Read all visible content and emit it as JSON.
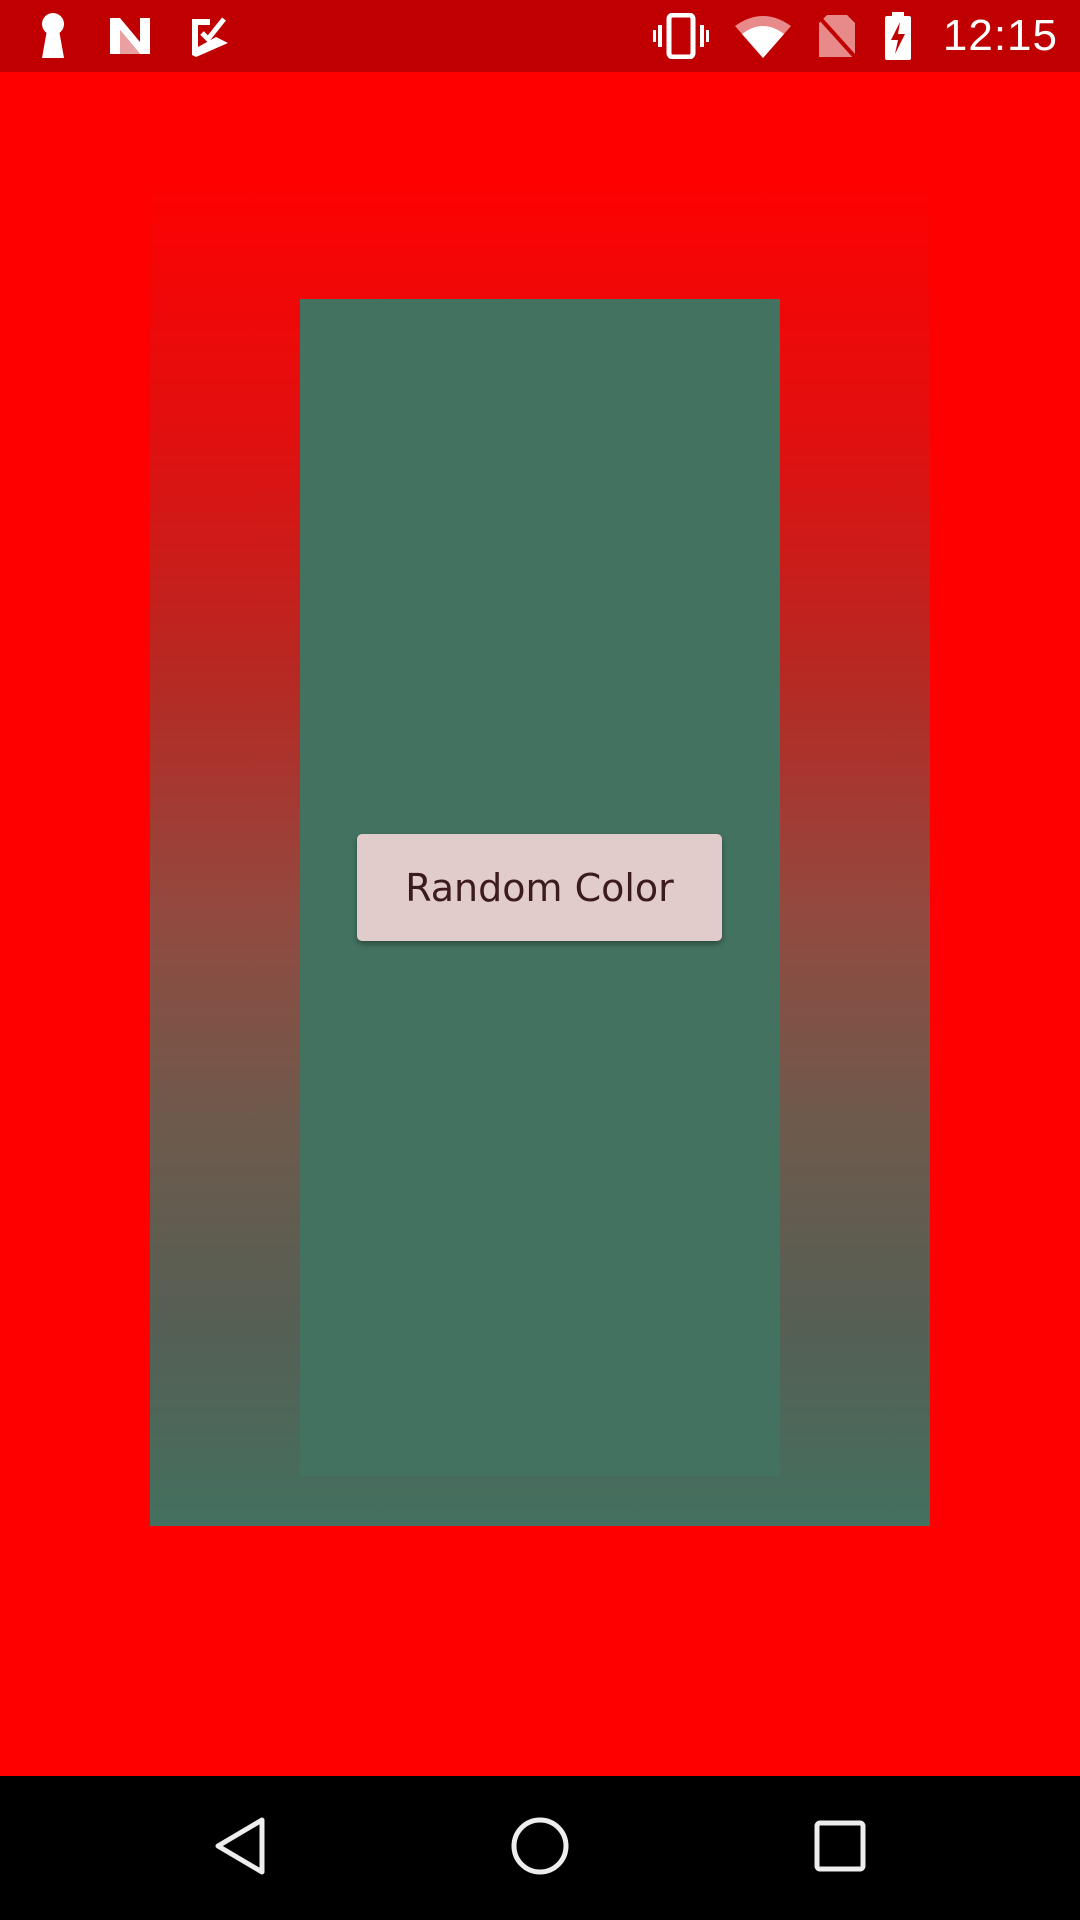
{
  "status_bar": {
    "time": "12:15",
    "background_color": "#c00000",
    "left_icons": [
      "keyhole-icon",
      "n-logo-icon",
      "task-check-icon"
    ],
    "right_icons": [
      "vibrate-icon",
      "wifi-icon",
      "no-sim-icon",
      "battery-charging-icon"
    ]
  },
  "main": {
    "background_color": "#ff0000",
    "gradient_top_color": "#ff0000",
    "gradient_bottom_color": "#44705f",
    "inner_panel_color": "#437261",
    "button": {
      "label": "Random Color",
      "background_color": "#e2cbcb",
      "text_color": "#3b1b1b"
    }
  },
  "nav_bar": {
    "icons": [
      "back-icon",
      "home-icon",
      "recents-icon"
    ]
  }
}
